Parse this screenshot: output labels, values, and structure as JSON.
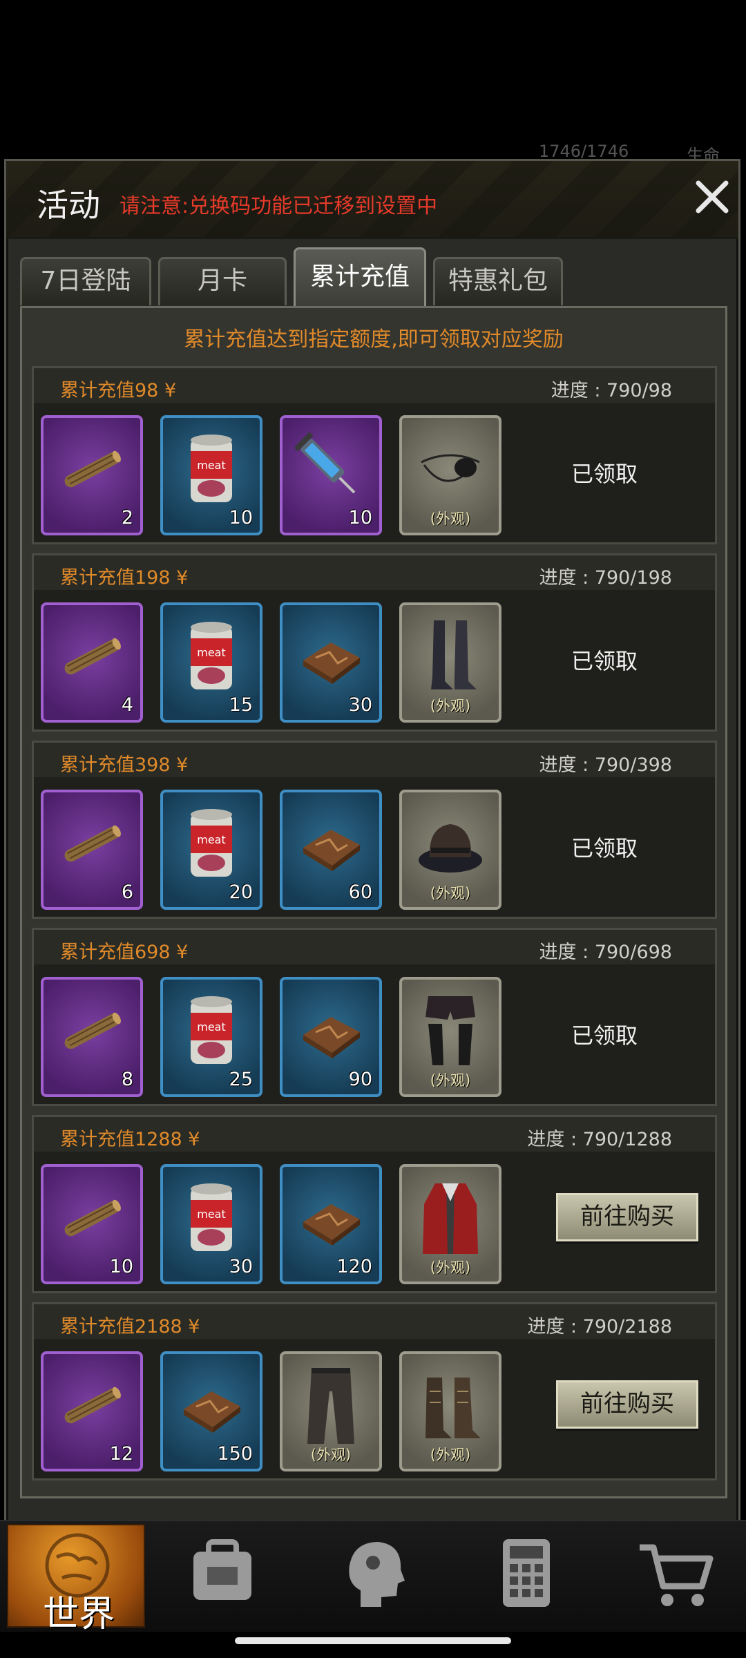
{
  "hud": {
    "resource_text": "1746/1746",
    "life_label": "生命"
  },
  "panel": {
    "title": "活动",
    "notice": "请注意:兑换码功能已迁移到设置中",
    "tabs": [
      {
        "label": "7日登陆"
      },
      {
        "label": "月卡"
      },
      {
        "label": "累计充值",
        "active": true
      },
      {
        "label": "特惠礼包"
      }
    ],
    "subtitle": "累计充值达到指定额度,即可领取对应奖励"
  },
  "tiers": [
    {
      "label": "累计充值98 ¥",
      "progress": "进度 : 790/98",
      "status": "已领取",
      "items": [
        {
          "icon": "cigar-icon",
          "rarity": "purple",
          "count": "2"
        },
        {
          "icon": "meat-can-icon",
          "rarity": "blue",
          "count": "10"
        },
        {
          "icon": "syringe-icon",
          "rarity": "purple",
          "count": "10"
        },
        {
          "icon": "eyepatch-icon",
          "rarity": "grey",
          "tag": "(外观)"
        }
      ]
    },
    {
      "label": "累计充值198 ¥",
      "progress": "进度 : 790/198",
      "status": "已领取",
      "items": [
        {
          "icon": "cigar-icon",
          "rarity": "purple",
          "count": "4"
        },
        {
          "icon": "meat-can-icon",
          "rarity": "blue",
          "count": "15"
        },
        {
          "icon": "map-box-icon",
          "rarity": "blue",
          "count": "30"
        },
        {
          "icon": "boots-icon",
          "rarity": "grey",
          "tag": "(外观)"
        }
      ]
    },
    {
      "label": "累计充值398 ¥",
      "progress": "进度 : 790/398",
      "status": "已领取",
      "items": [
        {
          "icon": "cigar-icon",
          "rarity": "purple",
          "count": "6"
        },
        {
          "icon": "meat-can-icon",
          "rarity": "blue",
          "count": "20"
        },
        {
          "icon": "map-box-icon",
          "rarity": "blue",
          "count": "60"
        },
        {
          "icon": "hat-icon",
          "rarity": "grey",
          "tag": "(外观)"
        }
      ]
    },
    {
      "label": "累计充值698 ¥",
      "progress": "进度 : 790/698",
      "status": "已领取",
      "items": [
        {
          "icon": "cigar-icon",
          "rarity": "purple",
          "count": "8"
        },
        {
          "icon": "meat-can-icon",
          "rarity": "blue",
          "count": "25"
        },
        {
          "icon": "map-box-icon",
          "rarity": "blue",
          "count": "90"
        },
        {
          "icon": "shorts-stockings-icon",
          "rarity": "grey",
          "tag": "(外观)"
        }
      ]
    },
    {
      "label": "累计充值1288 ¥",
      "progress": "进度 : 790/1288",
      "status": "前往购买",
      "items": [
        {
          "icon": "cigar-icon",
          "rarity": "purple",
          "count": "10"
        },
        {
          "icon": "meat-can-icon",
          "rarity": "blue",
          "count": "30"
        },
        {
          "icon": "map-box-icon",
          "rarity": "blue",
          "count": "120"
        },
        {
          "icon": "red-coat-icon",
          "rarity": "grey",
          "tag": "(外观)"
        }
      ]
    },
    {
      "label": "累计充值2188 ¥",
      "progress": "进度 : 790/2188",
      "status": "前往购买",
      "items": [
        {
          "icon": "cigar-icon",
          "rarity": "purple",
          "count": "12"
        },
        {
          "icon": "map-box-icon",
          "rarity": "blue",
          "count": "150"
        },
        {
          "icon": "trousers-icon",
          "rarity": "grey",
          "tag": "(外观)"
        },
        {
          "icon": "lace-boots-icon",
          "rarity": "grey",
          "tag": "(外观)"
        }
      ]
    }
  ],
  "bottom_nav": [
    {
      "label": "世界",
      "icon": "globe-icon",
      "active": true
    },
    {
      "icon": "backpack-icon"
    },
    {
      "icon": "head-profile-icon"
    },
    {
      "icon": "calculator-icon"
    },
    {
      "icon": "shopping-cart-icon"
    }
  ],
  "colors": {
    "accent_orange": "#e08a2a",
    "notice_red": "#e63a2a",
    "rarity_purple": "#a060d0",
    "rarity_blue": "#3f8ec4"
  }
}
